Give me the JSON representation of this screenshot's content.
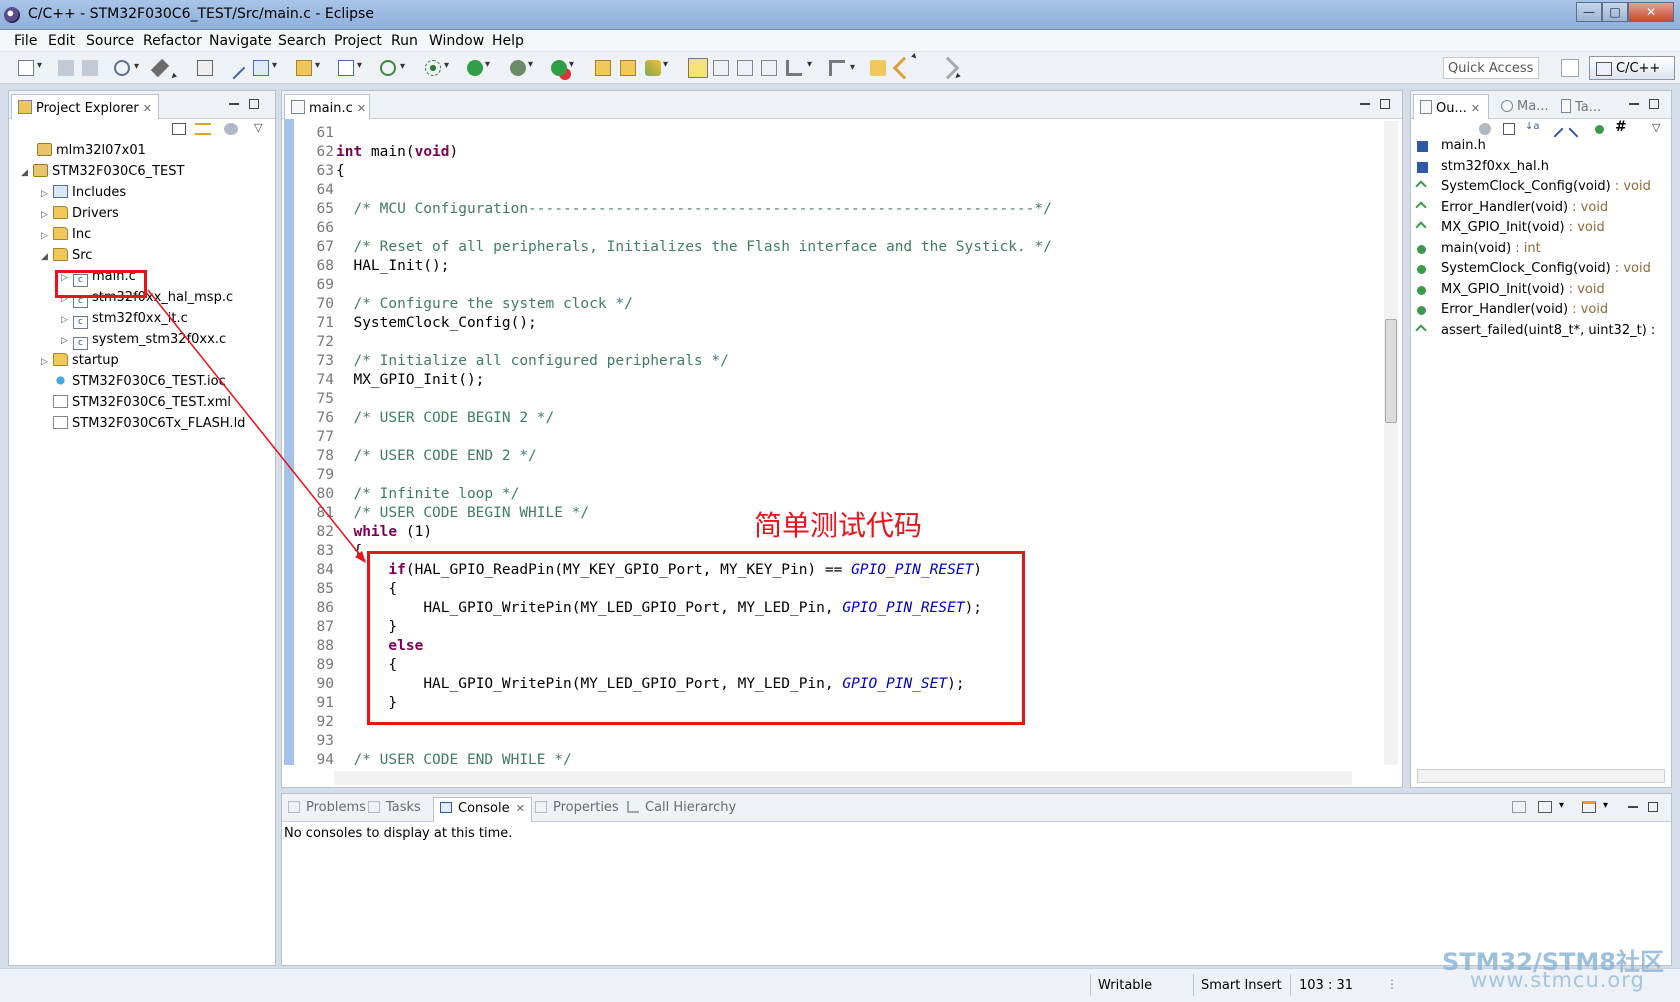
{
  "window": {
    "title": "C/C++ - STM32F030C6_TEST/Src/main.c - Eclipse",
    "min": "—",
    "max": "□",
    "close": "✕"
  },
  "menu": [
    "File",
    "Edit",
    "Source",
    "Refactor",
    "Navigate",
    "Search",
    "Project",
    "Run",
    "Window",
    "Help"
  ],
  "toolbar": {
    "quick_access": "Quick Access",
    "perspective": "C/C++"
  },
  "project_explorer": {
    "title": "Project Explorer",
    "items": [
      {
        "label": "mlm32l07x01",
        "icon": "project-icon"
      },
      {
        "label": "STM32F030C6_TEST",
        "icon": "project-icon"
      },
      {
        "label": "Includes",
        "icon": "includes-icon"
      },
      {
        "label": "Drivers",
        "icon": "folder-icon"
      },
      {
        "label": "Inc",
        "icon": "folder-icon"
      },
      {
        "label": "Src",
        "icon": "folder-icon"
      },
      {
        "label": "main.c",
        "icon": "c-file-icon"
      },
      {
        "label": "stm32f0xx_hal_msp.c",
        "icon": "c-file-icon"
      },
      {
        "label": "stm32f0xx_it.c",
        "icon": "c-file-icon"
      },
      {
        "label": "system_stm32f0xx.c",
        "icon": "c-file-icon"
      },
      {
        "label": "startup",
        "icon": "folder-icon"
      },
      {
        "label": "STM32F030C6_TEST.ioc",
        "icon": "ioc-file-icon"
      },
      {
        "label": "STM32F030C6_TEST.xml",
        "icon": "xml-file-icon"
      },
      {
        "label": "STM32F030C6Tx_FLASH.ld",
        "icon": "ld-file-icon"
      }
    ]
  },
  "editor": {
    "tab": "main.c",
    "lines": [
      {
        "n": "61",
        "t": ""
      },
      {
        "n": "62",
        "t": ""
      },
      {
        "n": "63",
        "t": "{"
      },
      {
        "n": "64",
        "t": ""
      },
      {
        "n": "65",
        "t": "  /* MCU Configuration----------------------------------------------------------*/"
      },
      {
        "n": "66",
        "t": ""
      },
      {
        "n": "67",
        "t": "  /* Reset of all peripherals, Initializes the Flash interface and the Systick. */"
      },
      {
        "n": "68",
        "t": "  HAL_Init();"
      },
      {
        "n": "69",
        "t": ""
      },
      {
        "n": "70",
        "t": "  /* Configure the system clock */"
      },
      {
        "n": "71",
        "t": "  SystemClock_Config();"
      },
      {
        "n": "72",
        "t": ""
      },
      {
        "n": "73",
        "t": "  /* Initialize all configured peripherals */"
      },
      {
        "n": "74",
        "t": "  MX_GPIO_Init();"
      },
      {
        "n": "75",
        "t": ""
      },
      {
        "n": "76",
        "t": "  /* USER CODE BEGIN 2 */"
      },
      {
        "n": "77",
        "t": ""
      },
      {
        "n": "78",
        "t": "  /* USER CODE END 2 */"
      },
      {
        "n": "79",
        "t": ""
      },
      {
        "n": "80",
        "t": "  /* Infinite loop */"
      },
      {
        "n": "81",
        "t": "  /* USER CODE BEGIN WHILE */"
      },
      {
        "n": "82",
        "t": ""
      },
      {
        "n": "83",
        "t": "  {"
      },
      {
        "n": "84",
        "t": ""
      },
      {
        "n": "85",
        "t": "      {"
      },
      {
        "n": "86",
        "t": ""
      },
      {
        "n": "87",
        "t": "      }"
      },
      {
        "n": "88",
        "t": ""
      },
      {
        "n": "89",
        "t": "      {"
      },
      {
        "n": "90",
        "t": ""
      },
      {
        "n": "91",
        "t": "      }"
      },
      {
        "n": "92",
        "t": ""
      },
      {
        "n": "93",
        "t": ""
      },
      {
        "n": "94",
        "t": "  /* USER CODE END WHILE */"
      }
    ],
    "rich": {
      "l62_kw1": "int",
      "l62_fn": " main(",
      "l62_kw2": "void",
      "l62_end": ")",
      "l82_kw": "while",
      "l82_end": " (1)",
      "l84_kw": "if",
      "l84_mid": "(HAL_GPIO_ReadPin(MY_KEY_GPIO_Port, MY_KEY_Pin) == ",
      "l84_cn": "GPIO_PIN_RESET",
      "l84_end": ")",
      "l86_mid": "HAL_GPIO_WritePin(MY_LED_GPIO_Port, MY_LED_Pin, ",
      "l86_cn": "GPIO_PIN_RESET",
      "l86_end": ");",
      "l88_kw": "else",
      "l90_mid": "HAL_GPIO_WritePin(MY_LED_GPIO_Port, MY_LED_Pin, ",
      "l90_cn": "GPIO_PIN_SET",
      "l90_end": ");"
    }
  },
  "outline": {
    "tabs": [
      "Ou...",
      "Ma...",
      "Ta..."
    ],
    "items": [
      {
        "name": "main.h",
        "type": "",
        "kind": "hdr"
      },
      {
        "name": "stm32f0xx_hal.h",
        "type": "",
        "kind": "hdr"
      },
      {
        "name": "SystemClock_Config(void)",
        "type": " : void",
        "kind": "decl"
      },
      {
        "name": "Error_Handler(void)",
        "type": " : void",
        "kind": "decl"
      },
      {
        "name": "MX_GPIO_Init(void)",
        "type": " : void",
        "kind": "decl"
      },
      {
        "name": "main(void)",
        "type": " : int",
        "kind": "fn"
      },
      {
        "name": "SystemClock_Config(void)",
        "type": " : void",
        "kind": "fn"
      },
      {
        "name": "MX_GPIO_Init(void)",
        "type": " : void",
        "kind": "fn"
      },
      {
        "name": "Error_Handler(void)",
        "type": " : void",
        "kind": "fn"
      },
      {
        "name": "assert_failed(uint8_t*, uint32_t) :",
        "type": "",
        "kind": "decl"
      }
    ]
  },
  "console": {
    "tabs": [
      "Problems",
      "Tasks",
      "Console",
      "Properties",
      "Call Hierarchy"
    ],
    "message": "No consoles to display at this time."
  },
  "status": {
    "mode": "Writable",
    "insert": "Smart Insert",
    "position": "103 : 31"
  },
  "annotation": {
    "label": "简单测试代码"
  },
  "watermark": {
    "line1": "STM32/STM8社区",
    "line2": "www.stmcu.org"
  },
  "colors": {
    "annotation_red": "#e8131b",
    "keyword": "#7f0055",
    "comment": "#3f7f5f",
    "constant": "#0000c0"
  }
}
